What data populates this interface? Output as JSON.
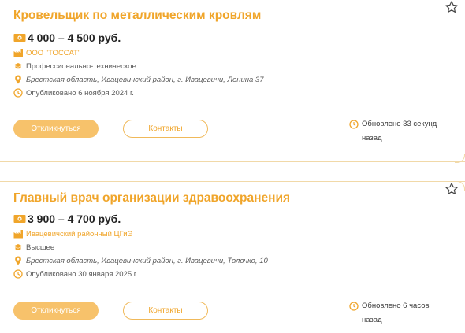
{
  "vacancies": [
    {
      "title": "Кровельщик по металлическим кровлям",
      "salary": "4 000 – 4 500 руб.",
      "company": "ООО \"ТОССАТ\"",
      "education": "Профессионально-техническое",
      "address": "Брестская область, Ивацевичский район, г. Ивацевичи, Ленина 37",
      "published": "Опубликовано 6 ноября 2024 г.",
      "respond_label": "Откликнуться",
      "contacts_label": "Контакты",
      "updated_line1": "Обновлено 33 секунд",
      "updated_line2": "назад"
    },
    {
      "title": "Главный врач организации здравоохранения",
      "salary": "3 900 – 4 700 руб.",
      "company": "Ивацевичский районный ЦГиЭ",
      "education": "Высшее",
      "address": "Брестская область, Ивацевичский район, г. Ивацевичи, Толочко, 10",
      "published": "Опубликовано 30 января 2025 г.",
      "respond_label": "Откликнуться",
      "contacts_label": "Контакты",
      "updated_line1": "Обновлено 6 часов",
      "updated_line2": "назад"
    }
  ],
  "icons": {
    "favorite": "star-icon",
    "salary": "money-icon",
    "company": "factory-icon",
    "education": "graduation-cap-icon",
    "address": "location-pin-icon",
    "published": "clock-icon",
    "updated": "clock-icon"
  },
  "colors": {
    "accent": "#f0a52a",
    "button_fill": "#f7c26b",
    "divider": "#f1d9a8"
  }
}
